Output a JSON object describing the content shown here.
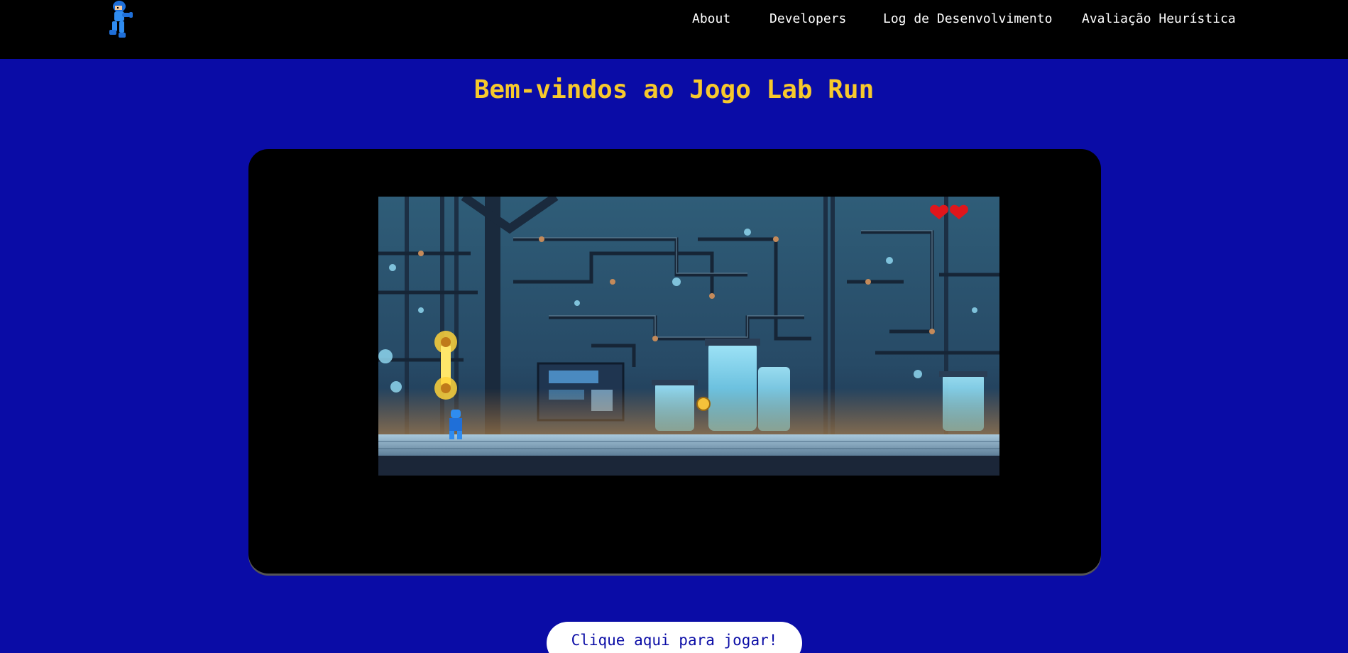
{
  "navbar": {
    "logo_icon": "megaman-sprite-icon",
    "links": [
      {
        "label": "About"
      },
      {
        "label": "Developers"
      },
      {
        "label": "Log de Desenvolvimento"
      },
      {
        "label": "Avaliação Heurística"
      }
    ]
  },
  "main": {
    "title": "Bem-vindos ao Jogo Lab Run",
    "play_button_label": "Clique aqui para jogar!"
  },
  "game": {
    "lives": 2,
    "scene": "laboratory",
    "hud_icon": "heart-icon"
  },
  "colors": {
    "background": "#0a0ca6",
    "navbar": "#000000",
    "title": "#f7c92c",
    "button_bg": "#ffffff",
    "button_text": "#0a0ca6"
  }
}
